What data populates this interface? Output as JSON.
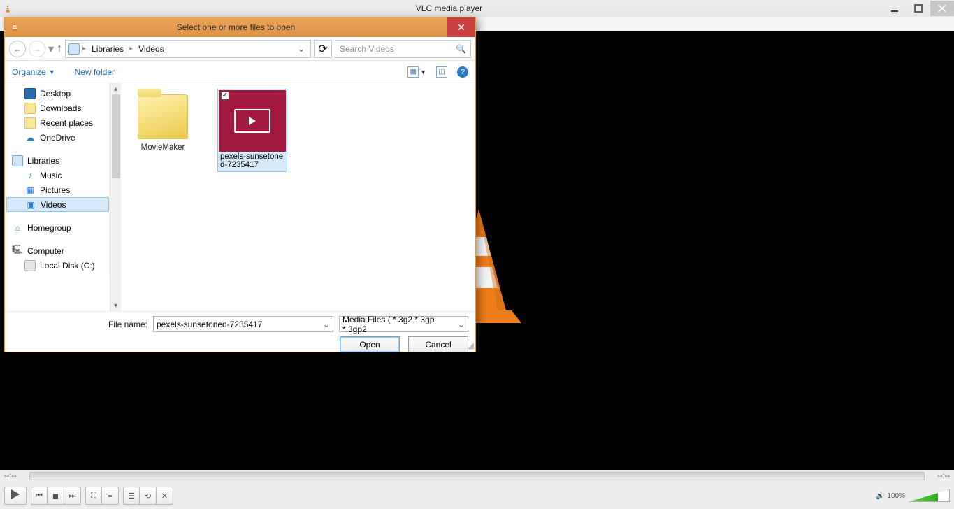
{
  "app": {
    "title": "VLC media player",
    "time_left": "--:--",
    "time_right": "--:--",
    "volume_pct": "100%",
    "volume_value": 100
  },
  "dialog": {
    "title": "Select one or more files to open",
    "breadcrumb": [
      "Libraries",
      "Videos"
    ],
    "search_placeholder": "Search Videos",
    "toolbar": {
      "organize": "Organize",
      "new_folder": "New folder"
    },
    "tree": {
      "desktop": "Desktop",
      "downloads": "Downloads",
      "recent": "Recent places",
      "onedrive": "OneDrive",
      "libraries": "Libraries",
      "music": "Music",
      "pictures": "Pictures",
      "videos": "Videos",
      "homegroup": "Homegroup",
      "computer": "Computer",
      "local_c": "Local Disk (C:)"
    },
    "files": {
      "folder1": "MovieMaker",
      "video1_line1": "pexels-sunsetone",
      "video1_line2": "d-7235417",
      "video1_checked": "✓"
    },
    "footer": {
      "file_name_label": "File name:",
      "file_name_value": "pexels-sunsetoned-7235417",
      "filter_value": "Media Files ( *.3g2 *.3gp *.3gp2",
      "open": "Open",
      "cancel": "Cancel"
    }
  }
}
